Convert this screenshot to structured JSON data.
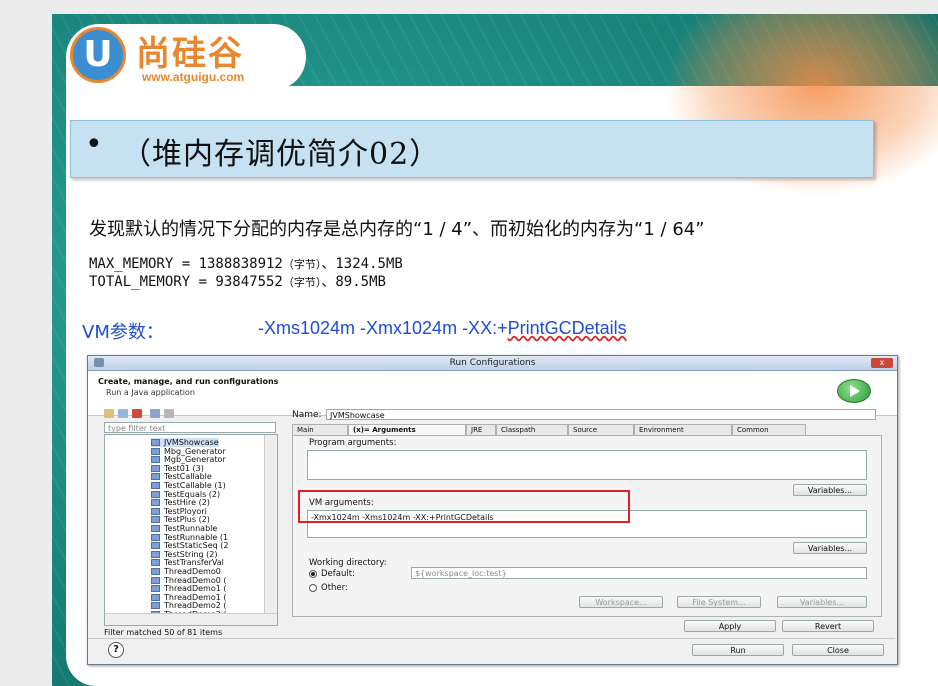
{
  "logo": {
    "letter": "U",
    "name_cn": "尚硅谷",
    "url": "www.atguigu.com"
  },
  "slide": {
    "bullet": "•",
    "title": "（堆内存调优简介02）",
    "description": "发现默认的情况下分配的内存是总内存的“1 / 4”、而初始化的内存为“1 / 64”",
    "max_memory": {
      "key": "MAX_MEMORY = 1388838912",
      "unit": "（字节）",
      "tail": "、1324.5MB"
    },
    "total_memory": {
      "key": "TOTAL_MEMORY = 93847552",
      "unit": "（字节）",
      "tail": "、89.5MB"
    },
    "vm_label": "VM参数：",
    "vm_value_main": "-Xms1024m -Xmx1024m -XX:+",
    "vm_value_tail": "PrintGCDetails"
  },
  "dialog": {
    "window_title": "Run Configurations",
    "close_label": "x",
    "header_title": "Create, manage, and run configurations",
    "header_subtitle": "Run a Java application",
    "filter_placeholder": "type filter text",
    "tree_items": [
      "JVMShowcase",
      "Mbg_Generator",
      "Mgb_Generator",
      "Test01 (3)",
      "TestCallable",
      "TestCallable (1)",
      "TestEquals (2)",
      "TestHire (2)",
      "TestPloyori",
      "TestPlus (2)",
      "TestRunnable",
      "TestRunnable (1",
      "TestStaticSeq (2",
      "TestString (2)",
      "TestTransferVal",
      "ThreadDemo0",
      "ThreadDemo0 (",
      "ThreadDemo1 (",
      "ThreadDemo1 (",
      "ThreadDemo2 (",
      "ThreadDemo2 ("
    ],
    "status": "Filter matched 50 of 81 items",
    "name_label": "Name:",
    "name_value": "JVMShowcase",
    "tabs": [
      "Main",
      "(x)= Arguments",
      "JRE",
      "Classpath",
      "Source",
      "Environment",
      "Common"
    ],
    "program_args_label": "Program arguments:",
    "variables_label": "Variables...",
    "vm_args_label": "VM arguments:",
    "vm_args_value": "-Xmx1024m -Xms1024m -XX:+PrintGCDetails",
    "working_dir_label": "Working directory:",
    "default_label": "Default:",
    "default_value": "${workspace_loc:test}",
    "other_label": "Other:",
    "workspace_btn": "Workspace...",
    "filesystem_btn": "File System...",
    "variables_btn2": "Variables...",
    "apply": "Apply",
    "revert": "Revert",
    "run": "Run",
    "close": "Close",
    "help": "?"
  }
}
